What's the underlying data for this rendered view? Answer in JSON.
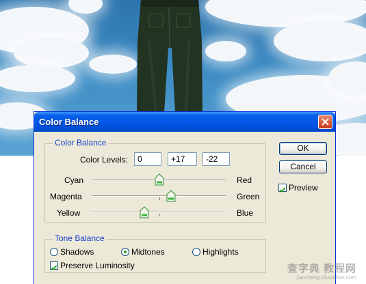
{
  "dialog": {
    "title": "Color Balance",
    "color_balance_group": {
      "legend": "Color Balance",
      "levels_label": "Color Levels:",
      "levels": [
        "0",
        "+17",
        "-22"
      ],
      "sliders": [
        {
          "left": "Cyan",
          "right": "Red",
          "value": 0
        },
        {
          "left": "Magenta",
          "right": "Green",
          "value": 17
        },
        {
          "left": "Yellow",
          "right": "Blue",
          "value": -22
        }
      ]
    },
    "tone_balance_group": {
      "legend": "Tone Balance",
      "options": [
        "Shadows",
        "Midtones",
        "Highlights"
      ],
      "selected": "Midtones",
      "preserve_luminosity_label": "Preserve Luminosity",
      "preserve_luminosity_checked": true
    },
    "buttons": {
      "ok": "OK",
      "cancel": "Cancel"
    },
    "preview_label": "Preview",
    "preview_checked": true
  },
  "watermark": {
    "text": "查字典 教程网",
    "url": "jiaocheng.chazidian.com"
  },
  "colors": {
    "titlebar": "#0055e5",
    "dialog_bg": "#ece9d8",
    "legend_text": "#1640c8",
    "sky": "#3d8cc4"
  }
}
